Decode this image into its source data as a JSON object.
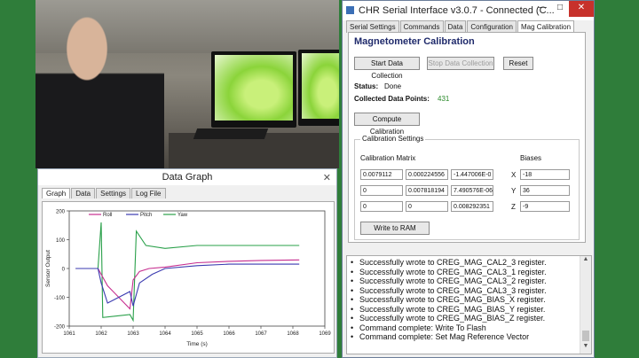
{
  "graph_window": {
    "title": "Data Graph",
    "close": "✕",
    "tabs": [
      "Graph",
      "Data",
      "Settings",
      "Log File"
    ]
  },
  "chart_data": {
    "type": "line",
    "xlabel": "Time (s)",
    "ylabel": "Sensor Output",
    "xlim": [
      1061,
      1069
    ],
    "ylim": [
      -200,
      200
    ],
    "xticks": [
      1061,
      1062,
      1063,
      1064,
      1065,
      1066,
      1067,
      1068,
      1069
    ],
    "yticks": [
      200,
      100,
      0,
      -100,
      -200
    ],
    "legend": [
      "Roll",
      "Pitch",
      "Yaw"
    ],
    "legend_position": "top",
    "colors": {
      "Roll": "#c62d8f",
      "Pitch": "#3a3ab0",
      "Yaw": "#2aa04a"
    },
    "series": [
      {
        "name": "Yaw",
        "x": [
          1061.2,
          1061.9,
          1062.0,
          1062.05,
          1062.9,
          1063.0,
          1063.1,
          1063.4,
          1064,
          1065,
          1066,
          1067,
          1068.2
        ],
        "y": [
          0,
          0,
          160,
          -170,
          -160,
          -180,
          130,
          80,
          70,
          80,
          80,
          80,
          80
        ]
      },
      {
        "name": "Roll",
        "x": [
          1061.2,
          1061.9,
          1062.0,
          1062.2,
          1062.9,
          1063.0,
          1063.2,
          1063.5,
          1064,
          1065,
          1066,
          1067,
          1068.2
        ],
        "y": [
          0,
          0,
          -20,
          -60,
          -140,
          -40,
          -10,
          0,
          5,
          20,
          25,
          28,
          30
        ]
      },
      {
        "name": "Pitch",
        "x": [
          1061.2,
          1061.9,
          1062.0,
          1062.2,
          1062.9,
          1063.0,
          1063.2,
          1063.6,
          1064,
          1065,
          1066,
          1067,
          1068.2
        ],
        "y": [
          0,
          0,
          -50,
          -120,
          -80,
          -130,
          -50,
          -20,
          0,
          10,
          15,
          15,
          15
        ]
      }
    ]
  },
  "chr_window": {
    "title": "CHR Serial Interface v3.0.7 - Connected (C...",
    "min": "—",
    "max": "□",
    "close": "✕",
    "tabs": [
      "Serial Settings",
      "Commands",
      "Data",
      "Configuration",
      "Mag Calibration"
    ],
    "active_tab": 4,
    "heading": "Magnetometer Calibration",
    "start_btn": "Start Data Collection",
    "stop_btn": "Stop Data Collection",
    "reset_btn": "Reset",
    "status_label": "Status:",
    "status_value": "Done",
    "points_label": "Collected Data Points:",
    "points_value": "431",
    "compute_btn": "Compute Calibration",
    "settings_label": "Calibration Settings",
    "matrix_label": "Calibration Matrix",
    "biases_label": "Biases",
    "matrix": [
      [
        "0.0079112",
        "0.000224556",
        "-1.447006E-0"
      ],
      [
        "0",
        "0.007818194",
        "7.490576E-06"
      ],
      [
        "0",
        "0",
        "0.008292351"
      ]
    ],
    "bias_axes": [
      "X",
      "Y",
      "Z"
    ],
    "biases": [
      "-18",
      "36",
      "-9"
    ],
    "write_btn": "Write to RAM",
    "log": [
      "Successfully wrote to CREG_MAG_CAL2_3 register.",
      "Successfully wrote to CREG_MAG_CAL3_1 register.",
      "Successfully wrote to CREG_MAG_CAL3_2 register.",
      "Successfully wrote to CREG_MAG_CAL3_3 register.",
      "Successfully wrote to CREG_MAG_BIAS_X register.",
      "Successfully wrote to CREG_MAG_BIAS_Y register.",
      "Successfully wrote to CREG_MAG_BIAS_Z register.",
      "Command complete: Write To Flash",
      "Command complete: Set Mag Reference Vector"
    ],
    "scroll_up": "▲",
    "scroll_down": "▼"
  }
}
